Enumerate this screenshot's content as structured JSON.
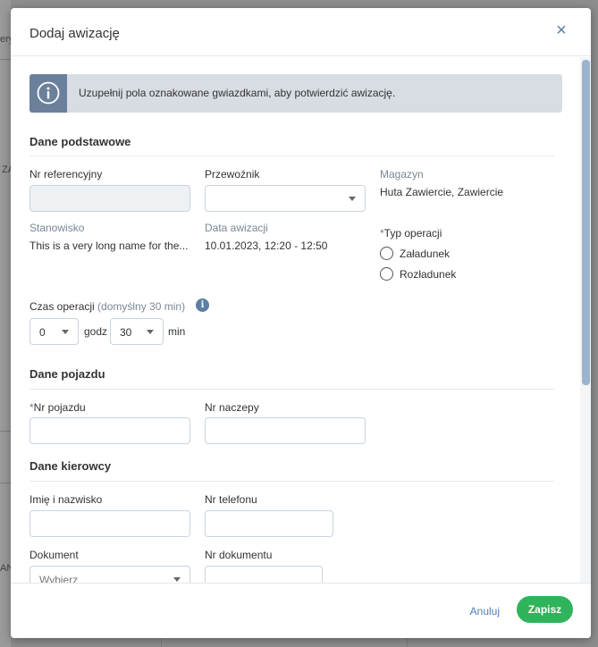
{
  "background": {
    "left_text_1": "ery",
    "left_text_2": "ZA",
    "left_text_3": "AN"
  },
  "modal": {
    "title": "Dodaj awizację",
    "close_glyph": "×",
    "alert": {
      "icon": "info-icon",
      "text": "Uzupełnij pola oznakowane gwiazdkami, aby potwierdzić awizację."
    },
    "sections": {
      "basic": "Dane podstawowe",
      "vehicle": "Dane pojazdu",
      "driver": "Dane kierowcy"
    },
    "basic": {
      "ref_label": "Nr referencyjny",
      "ref_value": "",
      "carrier_label": "Przewoźnik",
      "carrier_value": "",
      "warehouse_label": "Magazyn",
      "warehouse_value": "Huta Zawiercie, Zawiercie",
      "stand_label": "Stanowisko",
      "stand_value": "This is a very long name for the...",
      "date_label": "Data awizacji",
      "date_value": "10.01.2023, 12:20 - 12:50",
      "op_type_label": "Typ operacji",
      "op_type_required": "*",
      "op_load": "Załadunek",
      "op_unload": "Rozładunek",
      "op_time_label": "Czas operacji",
      "op_time_default": "(domyślny 30 min)",
      "hours_value": "0",
      "hours_unit": "godz",
      "minutes_value": "30",
      "minutes_unit": "min"
    },
    "vehicle": {
      "plate_required": "*",
      "plate_label": "Nr pojazdu",
      "trailer_label": "Nr naczepy"
    },
    "driver": {
      "name_label": "Imię i nazwisko",
      "phone_label": "Nr telefonu",
      "doc_label": "Dokument",
      "doc_placeholder": "Wybierz",
      "doc_no_label": "Nr dokumentu"
    },
    "footer": {
      "cancel": "Anuluj",
      "save": "Zapisz"
    },
    "colors": {
      "accent": "#5b7fa3",
      "save": "#2fb35b",
      "alert_bg": "#d8dde4"
    }
  }
}
